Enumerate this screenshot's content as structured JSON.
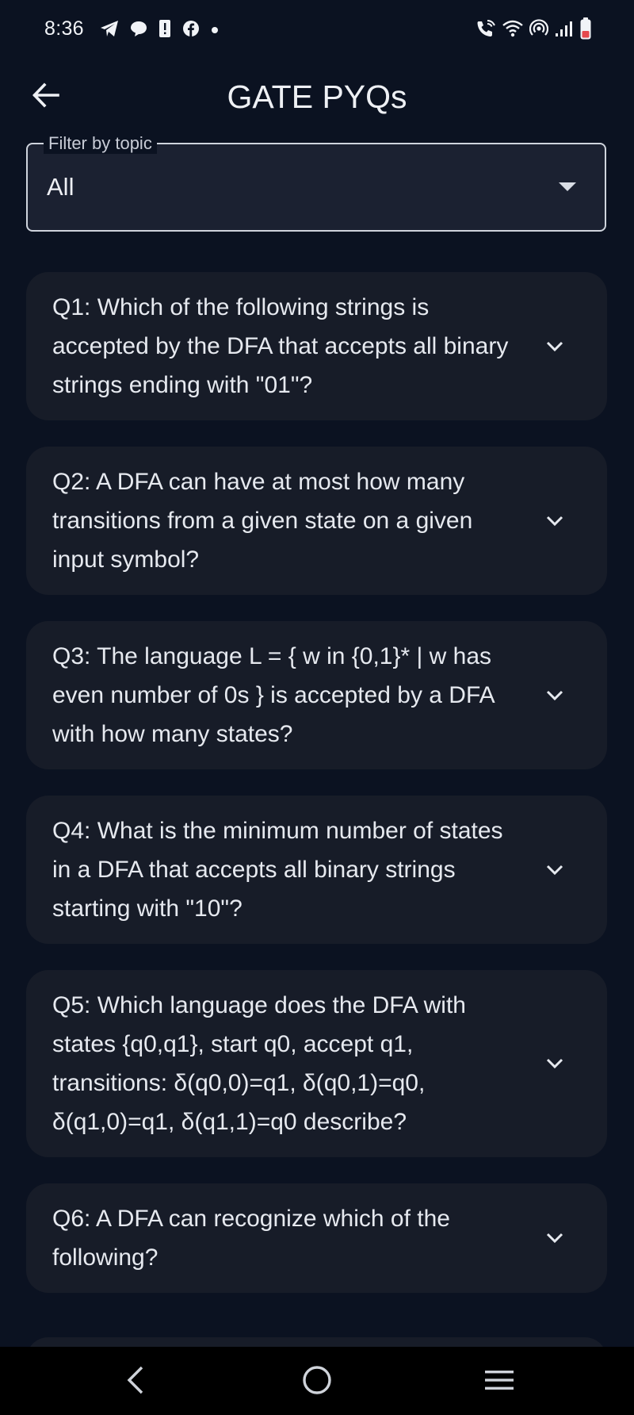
{
  "status_bar": {
    "time": "8:36",
    "left_icons": [
      "telegram-icon",
      "chat-bubble-icon",
      "alert-icon",
      "facebook-icon",
      "dot-icon"
    ],
    "right_icons": [
      "wifi-calling-icon",
      "wifi-icon",
      "hotspot-icon",
      "cellular-signal-icon",
      "battery-low-icon"
    ],
    "battery_color": "#e5484d"
  },
  "app_bar": {
    "title": "GATE PYQs",
    "back_icon": "arrow-left-icon"
  },
  "filter": {
    "label": "Filter by topic",
    "value": "All"
  },
  "questions": [
    {
      "text": "Q1: Which of the following strings is accepted by the DFA that accepts all binary strings ending with \"01\"?"
    },
    {
      "text": "Q2: A DFA can have at most how many transitions from a given state on a given input symbol?"
    },
    {
      "text": "Q3: The language L = { w in {0,1}* | w has even number of 0s } is accepted by a DFA with how many states?"
    },
    {
      "text": "Q4: What is the minimum number of states in a DFA that accepts all binary strings starting with \"10\"?"
    },
    {
      "text": "Q5: Which language does the DFA with states {q0,q1}, start q0, accept q1, transitions: δ(q0,0)=q1, δ(q0,1)=q0, δ(q1,0)=q1, δ(q1,1)=q0 describe?"
    },
    {
      "text": "Q6: A DFA can recognize which of the following?"
    }
  ],
  "nav_bar": {
    "icons": [
      "nav-back-icon",
      "nav-home-icon",
      "nav-recents-icon"
    ]
  },
  "colors": {
    "background": "#0b1221",
    "card": "#171c28",
    "text": "#e6e9ef"
  }
}
